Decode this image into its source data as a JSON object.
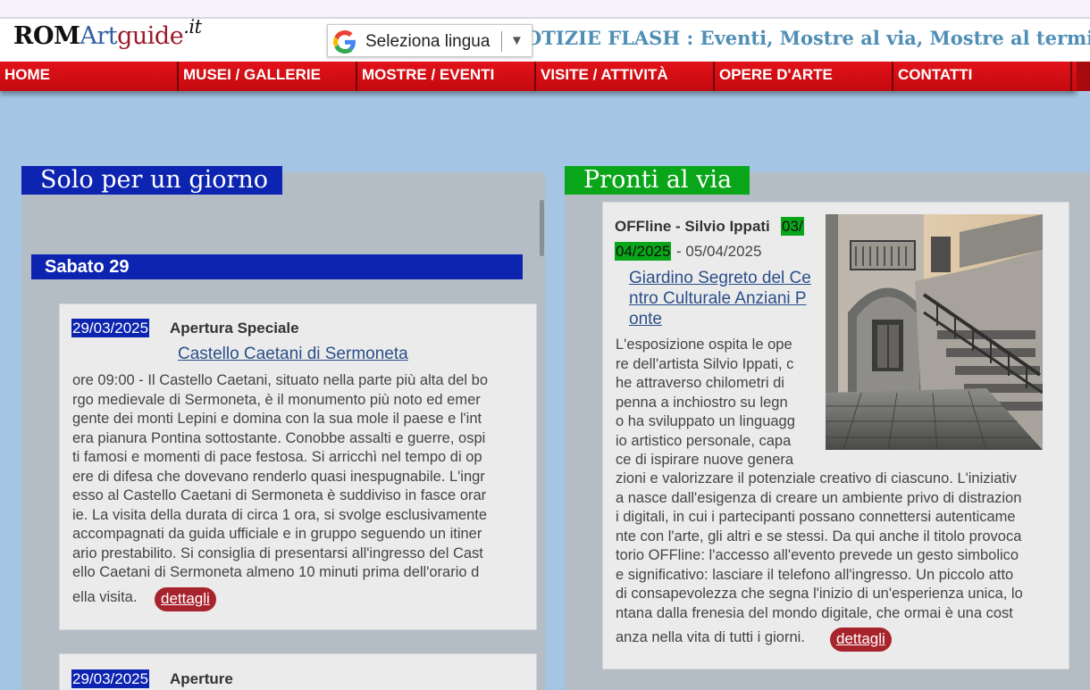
{
  "header": {
    "logo": {
      "rom": "ROM",
      "art": "Art",
      "guide": "guide",
      "tld": ".it"
    },
    "flash": "OTIZIE FLASH : Eventi, Mostre al via, Mostre al termine",
    "language_selector": {
      "label": "Seleziona lingua",
      "arrow": "▼"
    }
  },
  "nav": [
    "HOME",
    "MUSEI / GALLERIE",
    "MOSTRE / EVENTI",
    "VISITE / ATTIVITÀ",
    "OPERE D'ARTE",
    "CONTATTI"
  ],
  "left": {
    "title": "Solo per un giorno",
    "day": "Sabato 29",
    "card1": {
      "date": "29/03/2025",
      "type": "Apertura Speciale",
      "link": "Castello Caetani di Sermoneta",
      "lines": [
        "ore 09:00 - Il Castello Caetani, situato nella parte più alta del bo",
        "rgo medievale di Sermoneta, è il monumento più noto ed emer",
        "gente dei monti Lepini e domina con la sua mole il paese e l'int",
        "era pianura Pontina sottostante. Conobbe assalti e guerre, ospi",
        "ti famosi e momenti di pace festosa. Si arricchì nel tempo di op",
        "ere di difesa che dovevano renderlo quasi inespugnabile. L'ingr",
        "esso al Castello Caetani di Sermoneta è suddiviso in fasce orar",
        "ie. La visita della durata di circa 1 ora, si svolge esclusivamente",
        "accompagnati da guida ufficiale e in gruppo seguendo un itiner",
        "ario prestabilito. Si consiglia di presentarsi all'ingresso del Cast",
        "ello Caetani di Sermoneta almeno 10 minuti prima dell'orario d",
        "ella visita."
      ],
      "button": "dettagli"
    },
    "card2": {
      "date": "29/03/2025",
      "type": "Aperture"
    }
  },
  "right": {
    "title": "Pronti al via",
    "card": {
      "title": "OFFline - Silvio Ippati",
      "date_start_part1": "03/",
      "date_start_part2": "04/2025",
      "date_end": " - 05/04/2025",
      "link_lines": [
        "Giardino Segreto del Ce",
        "ntro Culturale Anziani P",
        "onte"
      ],
      "narrow_lines": [
        "L'esposizione ospita le ope",
        "re dell'artista Silvio Ippati, c",
        "he attraverso chilometri di",
        "penna a inchiostro su legn",
        "o ha sviluppato un linguagg",
        "io artistico personale, capa",
        "ce di ispirare nuove genera"
      ],
      "wide_lines": [
        "zioni e valorizzare il potenziale creativo di ciascuno. L'iniziativ",
        "a nasce dall'esigenza di creare un ambiente privo di distrazion",
        "i digitali, in cui i partecipanti possano connettersi autenticame",
        "nte con l'arte, gli altri e se stessi. Da qui anche il titolo provoca",
        "torio OFFline: l'accesso all'evento prevede un gesto simbolico",
        "e significativo: lasciare il telefono all'ingresso. Un piccolo atto",
        "di consapevolezza che segna l'inizio di un'esperienza unica, lo",
        "ntana dalla frenesia del mondo digitale, che ormai è una cost",
        "anza nella vita di tutti i giorni."
      ],
      "button": "dettagli"
    }
  },
  "colors": {
    "nav_red": "#e21219",
    "left_title_blue": "#0d24b1",
    "right_title_green": "#0aa61a",
    "button_red": "#a8242d",
    "page_bg": "#a4c6e4"
  }
}
